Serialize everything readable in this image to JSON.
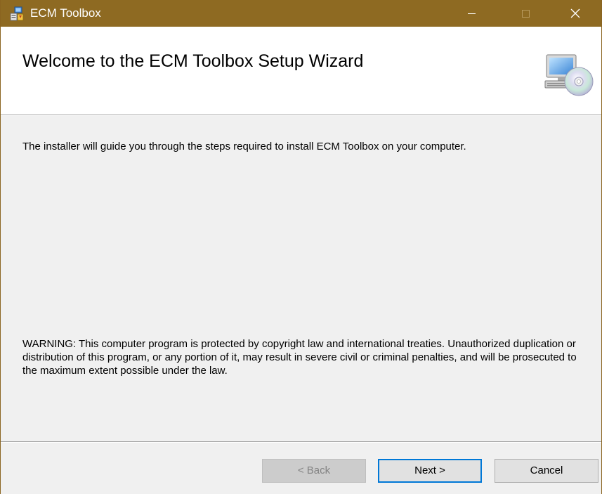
{
  "window": {
    "title": "ECM Toolbox",
    "controls": {
      "minimize": "minimize",
      "maximize": "maximize",
      "close": "close"
    }
  },
  "header": {
    "heading": "Welcome to the ECM Toolbox Setup Wizard"
  },
  "content": {
    "intro": "The installer will guide you through the steps required to install ECM Toolbox on your computer.",
    "warning": "WARNING: This computer program is protected by copyright law and international treaties. Unauthorized duplication or distribution of this program, or any portion of it, may result in severe civil or criminal penalties, and will be prosecuted to the maximum extent possible under the law."
  },
  "buttons": {
    "back": "< Back",
    "next": "Next >",
    "cancel": "Cancel"
  },
  "colors": {
    "titlebar": "#8e6a22",
    "focus": "#0078d7"
  },
  "icons": {
    "app": "installer-icon",
    "header": "computer-disc-icon"
  }
}
